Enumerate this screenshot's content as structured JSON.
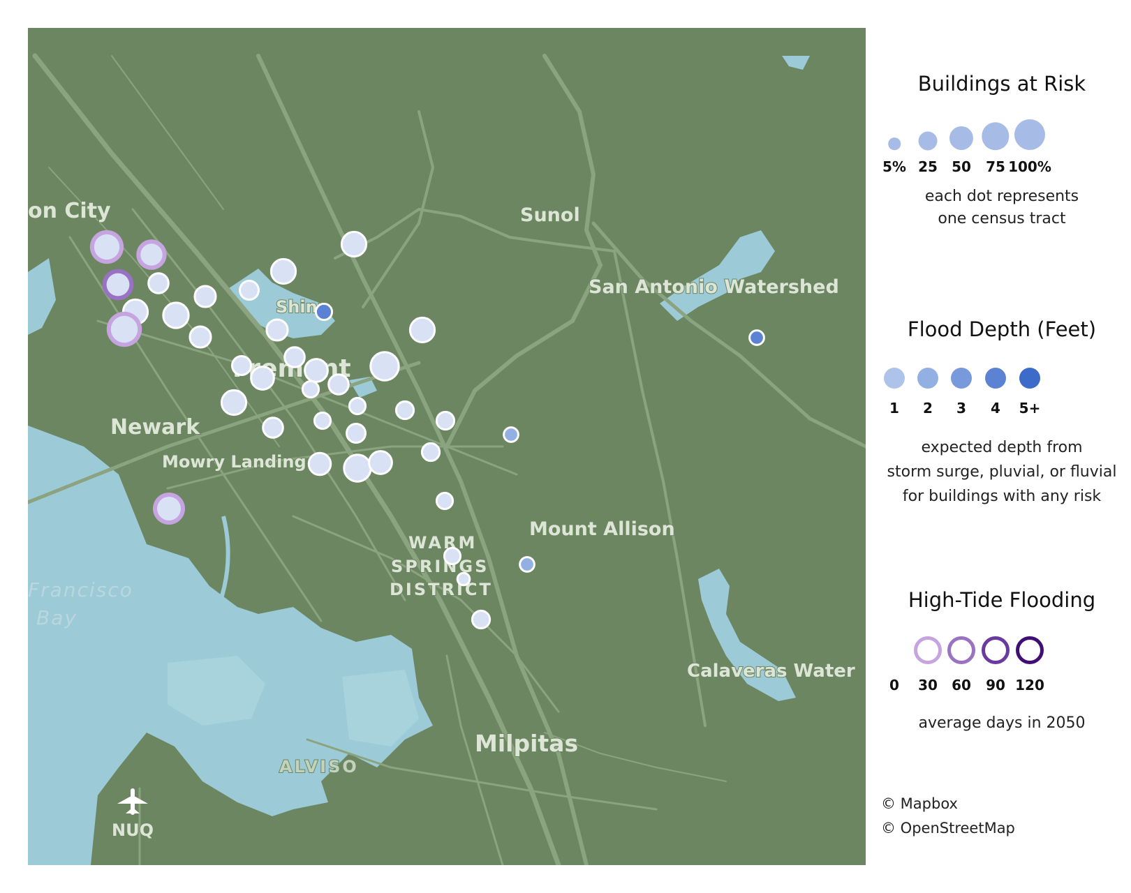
{
  "map": {
    "place_labels": {
      "union_city": "on City",
      "sunol": "Sunol",
      "san_antonio": "San Antonio Watershed",
      "fremont": "Fremont",
      "shinn": "Shinn",
      "newark": "Newark",
      "mowry": "Mowry Landing",
      "mount_allison": "Mount Allison",
      "warm": "WARM",
      "springs": "SPRINGS",
      "district": "DISTRICT",
      "francisco": "Francisco",
      "bay": "Bay",
      "calaveras": "Calaveras Water",
      "milpitas": "Milpitas",
      "alviso": "ALVISO",
      "nuq": "NUQ"
    },
    "colors": {
      "land": "#6b8660",
      "water": "#9ccad6",
      "roads": "#8ba47f",
      "dot_fill": "#d8e2f4",
      "dot_stroke": "#ffffff"
    },
    "tracts": [
      {
        "buildings_pct": 60,
        "depth": 1,
        "tide_days": 30
      },
      {
        "buildings_pct": 40,
        "depth": 1,
        "tide_days": 30
      },
      {
        "buildings_pct": 45,
        "depth": 1,
        "tide_days": 60
      },
      {
        "buildings_pct": 30,
        "depth": 1,
        "tide_days": 0
      },
      {
        "buildings_pct": 55,
        "depth": 1,
        "tide_days": 0
      },
      {
        "buildings_pct": 70,
        "depth": 1,
        "tide_days": 30
      },
      {
        "buildings_pct": 60,
        "depth": 1,
        "tide_days": 0
      },
      {
        "buildings_pct": 35,
        "depth": 1,
        "tide_days": 0
      },
      {
        "buildings_pct": 35,
        "depth": 1,
        "tide_days": 0
      },
      {
        "buildings_pct": 25,
        "depth": 1,
        "tide_days": 0
      },
      {
        "buildings_pct": 55,
        "depth": 1,
        "tide_days": 0
      },
      {
        "buildings_pct": 55,
        "depth": 1,
        "tide_days": 0
      },
      {
        "buildings_pct": 15,
        "depth": 4,
        "tide_days": 0
      },
      {
        "buildings_pct": 35,
        "depth": 1,
        "tide_days": 0
      },
      {
        "buildings_pct": 25,
        "depth": 1,
        "tide_days": 0
      },
      {
        "buildings_pct": 30,
        "depth": 1,
        "tide_days": 0
      },
      {
        "buildings_pct": 45,
        "depth": 1,
        "tide_days": 0
      },
      {
        "buildings_pct": 80,
        "depth": 1,
        "tide_days": 0
      },
      {
        "buildings_pct": 45,
        "depth": 1,
        "tide_days": 0
      },
      {
        "buildings_pct": 30,
        "depth": 1,
        "tide_days": 0
      },
      {
        "buildings_pct": 15,
        "depth": 1,
        "tide_days": 0
      },
      {
        "buildings_pct": 55,
        "depth": 1,
        "tide_days": 0
      },
      {
        "buildings_pct": 30,
        "depth": 1,
        "tide_days": 0
      },
      {
        "buildings_pct": 15,
        "depth": 1,
        "tide_days": 0
      },
      {
        "buildings_pct": 15,
        "depth": 1,
        "tide_days": 0
      },
      {
        "buildings_pct": 55,
        "depth": 1,
        "tide_days": 0
      },
      {
        "buildings_pct": 20,
        "depth": 1,
        "tide_days": 0
      },
      {
        "buildings_pct": 25,
        "depth": 1,
        "tide_days": 0
      },
      {
        "buildings_pct": 20,
        "depth": 1,
        "tide_days": 0
      },
      {
        "buildings_pct": 40,
        "depth": 1,
        "tide_days": 0
      },
      {
        "buildings_pct": 70,
        "depth": 1,
        "tide_days": 0
      },
      {
        "buildings_pct": 45,
        "depth": 1,
        "tide_days": 0
      },
      {
        "buildings_pct": 20,
        "depth": 1,
        "tide_days": 0
      },
      {
        "buildings_pct": 15,
        "depth": 1,
        "tide_days": 0
      },
      {
        "buildings_pct": 10,
        "depth": 2,
        "tide_days": 0
      },
      {
        "buildings_pct": 15,
        "depth": 1,
        "tide_days": 0
      },
      {
        "buildings_pct": 10,
        "depth": 2,
        "tide_days": 0
      },
      {
        "buildings_pct": 5,
        "depth": 1,
        "tide_days": 0
      },
      {
        "buildings_pct": 20,
        "depth": 1,
        "tide_days": 0
      },
      {
        "buildings_pct": 10,
        "depth": 4,
        "tide_days": 0
      },
      {
        "buildings_pct": 50,
        "depth": 1,
        "tide_days": 30
      }
    ]
  },
  "legend": {
    "buildings": {
      "title": "Buildings at Risk",
      "items": [
        {
          "label": "5%",
          "pct": 5
        },
        {
          "label": "25",
          "pct": 25
        },
        {
          "label": "50",
          "pct": 50
        },
        {
          "label": "75",
          "pct": 75
        },
        {
          "label": "100%",
          "pct": 100
        }
      ],
      "note_line1": "each dot represents",
      "note_line2": "one census tract"
    },
    "depth": {
      "title": "Flood Depth (Feet)",
      "items": [
        {
          "label": "1",
          "color": "#aec3ea"
        },
        {
          "label": "2",
          "color": "#93b0e3"
        },
        {
          "label": "3",
          "color": "#7899db"
        },
        {
          "label": "4",
          "color": "#5c83d3"
        },
        {
          "label": "5+",
          "color": "#3d6bc9"
        }
      ],
      "note_line1": "expected depth from",
      "note_line2": "storm surge, pluvial, or fluvial",
      "note_line3": "for buildings with any risk"
    },
    "tide": {
      "title": "High-Tide Flooding",
      "items": [
        {
          "label": "0",
          "color": "none"
        },
        {
          "label": "30",
          "color": "#c6a4e0"
        },
        {
          "label": "60",
          "color": "#9a72c2"
        },
        {
          "label": "90",
          "color": "#6a3a9e"
        },
        {
          "label": "120",
          "color": "#3f0f74"
        }
      ],
      "note": "average days in 2050"
    }
  },
  "credits": {
    "mapbox": "© Mapbox",
    "osm": "© OpenStreetMap"
  }
}
